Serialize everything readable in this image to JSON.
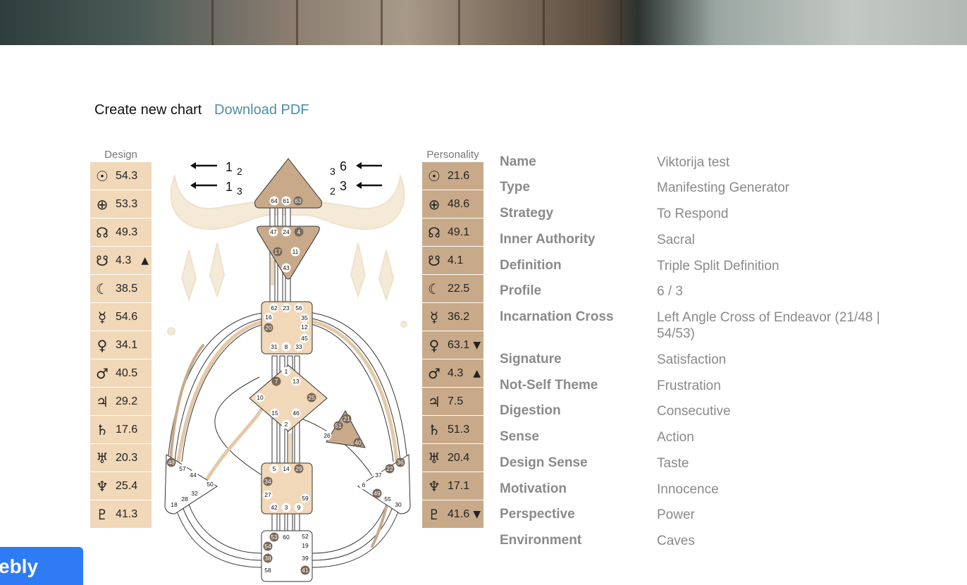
{
  "links": {
    "create": "Create new chart",
    "download": "Download PDF"
  },
  "design": {
    "heading": "Design",
    "rows": [
      {
        "icon": "sun-icon",
        "glyph": "☉",
        "value": "54.3",
        "arrow": ""
      },
      {
        "icon": "earth-icon",
        "glyph": "⊕",
        "value": "53.3",
        "arrow": ""
      },
      {
        "icon": "north-node-icon",
        "glyph": "☊",
        "value": "49.3",
        "arrow": ""
      },
      {
        "icon": "south-node-icon",
        "glyph": "☋",
        "value": "4.3",
        "arrow": "▲"
      },
      {
        "icon": "moon-icon",
        "glyph": "☾",
        "value": "38.5",
        "arrow": ""
      },
      {
        "icon": "mercury-icon",
        "glyph": "☿",
        "value": "54.6",
        "arrow": ""
      },
      {
        "icon": "venus-icon",
        "glyph": "♀",
        "value": "34.1",
        "arrow": ""
      },
      {
        "icon": "mars-icon",
        "glyph": "♂",
        "value": "40.5",
        "arrow": ""
      },
      {
        "icon": "jupiter-icon",
        "glyph": "♃",
        "value": "29.2",
        "arrow": ""
      },
      {
        "icon": "saturn-icon",
        "glyph": "♄",
        "value": "17.6",
        "arrow": ""
      },
      {
        "icon": "uranus-icon",
        "glyph": "♅",
        "value": "20.3",
        "arrow": ""
      },
      {
        "icon": "neptune-icon",
        "glyph": "♆",
        "value": "25.4",
        "arrow": ""
      },
      {
        "icon": "pluto-icon",
        "glyph": "♇",
        "value": "41.3",
        "arrow": ""
      }
    ]
  },
  "personality": {
    "heading": "Personality",
    "rows": [
      {
        "icon": "sun-icon",
        "glyph": "☉",
        "value": "21.6",
        "arrow": ""
      },
      {
        "icon": "earth-icon",
        "glyph": "⊕",
        "value": "48.6",
        "arrow": ""
      },
      {
        "icon": "north-node-icon",
        "glyph": "☊",
        "value": "49.1",
        "arrow": ""
      },
      {
        "icon": "south-node-icon",
        "glyph": "☋",
        "value": "4.1",
        "arrow": ""
      },
      {
        "icon": "moon-icon",
        "glyph": "☾",
        "value": "22.5",
        "arrow": ""
      },
      {
        "icon": "mercury-icon",
        "glyph": "☿",
        "value": "36.2",
        "arrow": ""
      },
      {
        "icon": "venus-icon",
        "glyph": "♀",
        "value": "63.1",
        "arrow": "▼"
      },
      {
        "icon": "mars-icon",
        "glyph": "♂",
        "value": "4.3",
        "arrow": "▲"
      },
      {
        "icon": "jupiter-icon",
        "glyph": "♃",
        "value": "7.5",
        "arrow": ""
      },
      {
        "icon": "saturn-icon",
        "glyph": "♄",
        "value": "51.3",
        "arrow": ""
      },
      {
        "icon": "uranus-icon",
        "glyph": "♅",
        "value": "20.4",
        "arrow": ""
      },
      {
        "icon": "neptune-icon",
        "glyph": "♆",
        "value": "17.1",
        "arrow": ""
      },
      {
        "icon": "pluto-icon",
        "glyph": "♇",
        "value": "41.6",
        "arrow": "▼"
      }
    ]
  },
  "variables": {
    "left_top": {
      "big": "1",
      "small": "2"
    },
    "left_bottom": {
      "big": "1",
      "small": "3"
    },
    "right_top": {
      "small": "3",
      "big": "6"
    },
    "right_bottom": {
      "small": "2",
      "big": "3"
    }
  },
  "bodygraph": {
    "colors": {
      "defined": "#c8aa8a",
      "design": "#f0d8b8",
      "open": "#ffffff",
      "activated_gate": "#7a6858",
      "outline": "#333333"
    },
    "head": [
      "64",
      "61",
      "63"
    ],
    "ajna": [
      "47",
      "24",
      "4",
      "17",
      "11",
      "43"
    ],
    "throat": [
      "62",
      "23",
      "56",
      "16",
      "35",
      "20",
      "12",
      "45",
      "31",
      "8",
      "33"
    ],
    "g": [
      "1",
      "7",
      "13",
      "10",
      "25",
      "15",
      "46",
      "2"
    ],
    "ego": [
      "21",
      "51",
      "26",
      "40"
    ],
    "sacral": [
      "5",
      "14",
      "29",
      "34",
      "27",
      "59",
      "42",
      "3",
      "9"
    ],
    "spleen": [
      "48",
      "57",
      "44",
      "50",
      "32",
      "28",
      "18"
    ],
    "solar": [
      "36",
      "22",
      "37",
      "6",
      "49",
      "55",
      "30"
    ],
    "root": [
      "53",
      "60",
      "52",
      "54",
      "19",
      "38",
      "39",
      "58",
      "41"
    ]
  },
  "properties": [
    {
      "key": "Name",
      "value": "Viktorija test"
    },
    {
      "key": "Type",
      "value": "Manifesting Generator"
    },
    {
      "key": "Strategy",
      "value": "To Respond"
    },
    {
      "key": "Inner Authority",
      "value": "Sacral"
    },
    {
      "key": "Definition",
      "value": "Triple Split Definition"
    },
    {
      "key": "Profile",
      "value": "6 / 3"
    },
    {
      "key": "Incarnation Cross",
      "value": "Left Angle Cross of Endeavor (21/48 | 54/53)"
    },
    {
      "key": "Signature",
      "value": "Satisfaction"
    },
    {
      "key": "Not-Self Theme",
      "value": "Frustration"
    },
    {
      "key": "Digestion",
      "value": "Consecutive"
    },
    {
      "key": "Sense",
      "value": "Action"
    },
    {
      "key": "Design Sense",
      "value": "Taste"
    },
    {
      "key": "Motivation",
      "value": "Innocence"
    },
    {
      "key": "Perspective",
      "value": "Power"
    },
    {
      "key": "Environment",
      "value": "Caves"
    }
  ],
  "badge": {
    "text": "ebly"
  }
}
